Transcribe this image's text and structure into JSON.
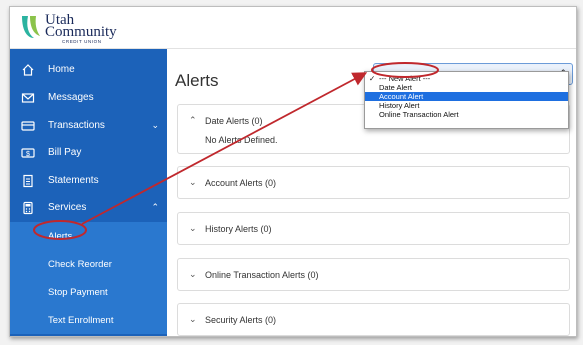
{
  "brand": {
    "line1": "Utah",
    "line2": "Community",
    "line3": "CREDIT UNION",
    "colors": {
      "navy": "#1a2a5a",
      "teal": "#2bb3a0",
      "green": "#8bc34a"
    }
  },
  "sidebar": {
    "items": [
      {
        "label": "Home",
        "icon": "home-icon"
      },
      {
        "label": "Messages",
        "icon": "envelope-icon"
      },
      {
        "label": "Transactions",
        "icon": "card-icon",
        "chevron": "⌄"
      },
      {
        "label": "Bill Pay",
        "icon": "dollar-icon"
      },
      {
        "label": "Statements",
        "icon": "document-icon"
      },
      {
        "label": "Services",
        "icon": "calculator-icon",
        "chevron": "⌃"
      }
    ],
    "sub_items": [
      {
        "label": "Alerts"
      },
      {
        "label": "Check Reorder"
      },
      {
        "label": "Stop Payment"
      },
      {
        "label": "Text Enrollment"
      }
    ],
    "color": "#1c62b9",
    "sub_color": "#2a78cf"
  },
  "main": {
    "title": "Alerts",
    "new_alert_select": {
      "selected": "--- New Alert ---",
      "options": [
        "--- New Alert ---",
        "Date Alert",
        "Account Alert",
        "History Alert",
        "Online Transaction Alert"
      ],
      "highlighted": "Account Alert"
    },
    "panels": [
      {
        "label": "Date Alerts (0)",
        "expanded": true,
        "body": "No Alerts Defined."
      },
      {
        "label": "Account Alerts (0)"
      },
      {
        "label": "History Alerts (0)"
      },
      {
        "label": "Online Transaction Alerts (0)"
      },
      {
        "label": "Security Alerts (0)"
      }
    ]
  },
  "annotation": {
    "color": "#c0282d"
  }
}
